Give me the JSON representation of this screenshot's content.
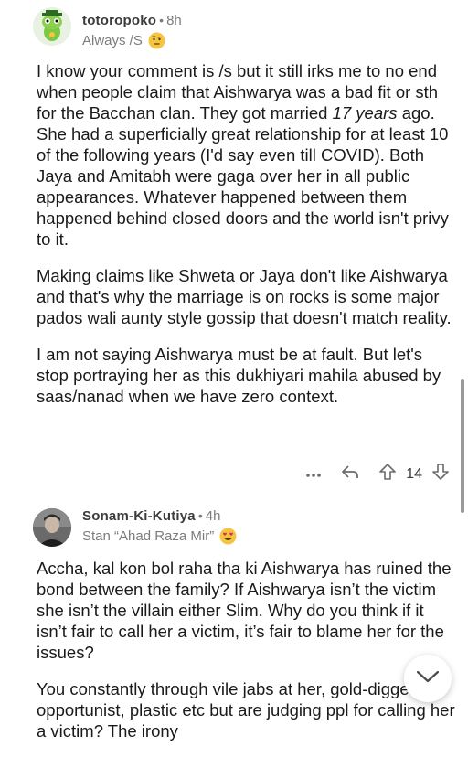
{
  "comments": [
    {
      "username": "totoropoko",
      "time": "8h",
      "flair": "Always /S",
      "flair_emoji": "raised-eyebrow-emoji",
      "paragraphs": [
        {
          "pre": "I know your comment is /s but it still irks me to no end when people claim that Aishwarya was a bad fit or sth for the Bacchan clan. They got married ",
          "em": "17 years",
          "post": " ago. She had a superficially great relationship for at least 10 of the following years (I'd say even till COVID). Both Jaya and Amitabh were gaga over her in all public appearances. Whatever happened between them happened behind closed doors and the world isn't privy to it."
        },
        {
          "pre": "Making claims like Shweta or Jaya don't like Aishwarya and that's why the marriage is on rocks is some major pados wali aunty style gossip that doesn't match reality.",
          "em": "",
          "post": ""
        },
        {
          "pre": "I am not saying Aishwarya must be at fault. But let's stop portraying her as this dukhiyari mahila abused by saas/nanad when we have zero context.",
          "em": "",
          "post": ""
        }
      ],
      "score": "14"
    },
    {
      "username": "Sonam-Ki-Kutiya",
      "time": "4h",
      "flair": "Stan “Ahad Raza Mir”",
      "flair_emoji": "heart-eyes-emoji",
      "paragraphs": [
        {
          "pre": "Accha, kal kon bol raha tha ki Aishwarya has ruined the bond between the family? If Aishwarya isn’t the victim she isn’t the villain either Slim. Why do you think if it isn’t fair to call her a victim, it’s fair to blame her for the issues?",
          "em": "",
          "post": ""
        },
        {
          "pre": "You constantly through vile jabs at her, gold-digger, opportunist, plastic etc but are judging ppl for calling her a victim? The irony",
          "em": "",
          "post": ""
        }
      ]
    }
  ],
  "colors": {
    "text": "#1a1a1b",
    "meta": "#7c7c7c",
    "accent_emoji": "#f5c542"
  }
}
